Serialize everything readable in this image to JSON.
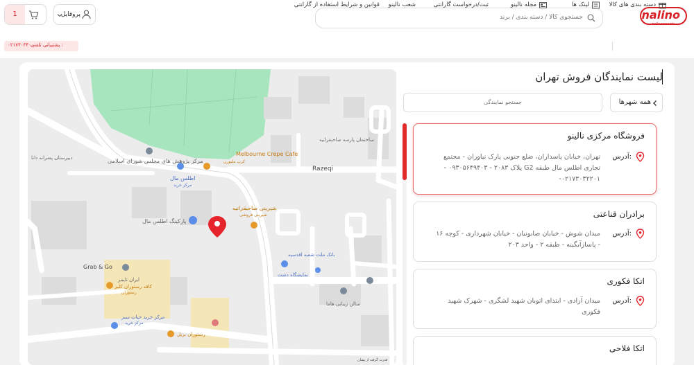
{
  "header": {
    "logo_text": "nalino",
    "logo_subtext": "nalinosweets",
    "search_placeholder": "جستجوی کالا / دسته بندی / برند",
    "profile_label": "پروفایل",
    "cart_count": "1",
    "support_label": "پشتیبانی تلفنی :",
    "support_number": "۰۲۱۷۳۰۳۴۰۰۰"
  },
  "nav": {
    "items": [
      {
        "label": "دسته بندی های کالا",
        "icon": "gift-icon"
      },
      {
        "label": "لینک ها",
        "icon": "list-icon"
      },
      {
        "label": "مجله نالینو",
        "icon": "newspaper-icon"
      },
      {
        "label": "ثبت/درخواست گارانتی",
        "icon": ""
      },
      {
        "label": "شعب نالینو",
        "icon": ""
      },
      {
        "label": "قوانین و شرایط استفاده از گارانتی",
        "icon": ""
      }
    ]
  },
  "page": {
    "title": "لیست نمایندگان فروش تهران",
    "city_filter_label": "همه شهرها",
    "rep_search_placeholder": "جستجو نمایندگی"
  },
  "stores": [
    {
      "name": "فروشگاه مرکزی نالینو",
      "address_label": "آدرس:",
      "address": "تهران، خیابان پاسداران، ضلع جنوبی پارک نیاوران - مجتمع تجاری اطلس مال طبقه G2 پلاک ۲۰۸۳ - ۰۹۳۰۵۶۴۹۴۰۳ - ۰۲۱۷۳۰۳۲۲۰۱-",
      "active": true
    },
    {
      "name": "برادران قناعتی",
      "address_label": "آدرس:",
      "address": "میدان شوش - خیابان صابونیان - خیابان شهرداری - کوچه ۱۶ - پاساژآبگینه - طبقه ۲ - واحد ۲۰۳",
      "active": false
    },
    {
      "name": "اتکا فکوری",
      "address_label": "آدرس:",
      "address": "میدان آزادی - ابتدای اتوبان شهید لشگری - شهرک شهید فکوری",
      "active": false
    },
    {
      "name": "اتکا فلاحی",
      "address_label": "آدرس:",
      "address": "",
      "active": false
    }
  ],
  "map": {
    "labels": {
      "melbourne": "Melbourne Crepe Cafe",
      "melbourne_fa": "کرپ ملبورن",
      "atlas_mall": "اطلس مال",
      "atlas_mall_sub": "مرکز خرید",
      "atlas_parking": "پارکینگ اطلس مال",
      "sahebgharanieh": "شیرینی صاحبقرانیه",
      "sahebgharanieh_sub": "شیرینی فروشی",
      "research_center": "مرکز پژوهش های مجلس شورای اسلامی",
      "girls_school": "دبیرستان پسرانه دانا",
      "park_building": "ساختمان پارسه صاحبقرانیه",
      "razeqi": "Razeqi",
      "bank": "بانک ملت شعبه اقدسیه",
      "dasht_gallery": "نمایشگاه دشت",
      "haima_salon": "سالن زیبایی هاما",
      "grab_go": "Grab & Go",
      "iran_timer": "ایران تایمر",
      "cafe_restaurant": "کافه رستوران کلیر",
      "cafe_restaurant_sub": "رستوران",
      "hyper_sabz": "مرکز خرید حیات سبز",
      "hyper_sabz_sub": "مرکز خرید",
      "restaurant_bril": "رستوران بریل",
      "attribution": "قدرت گرفته از نِشان"
    }
  },
  "colors": {
    "brand": "#d81f26",
    "park_green": "#a7e5bf",
    "accent_light": "#fde6e6"
  }
}
